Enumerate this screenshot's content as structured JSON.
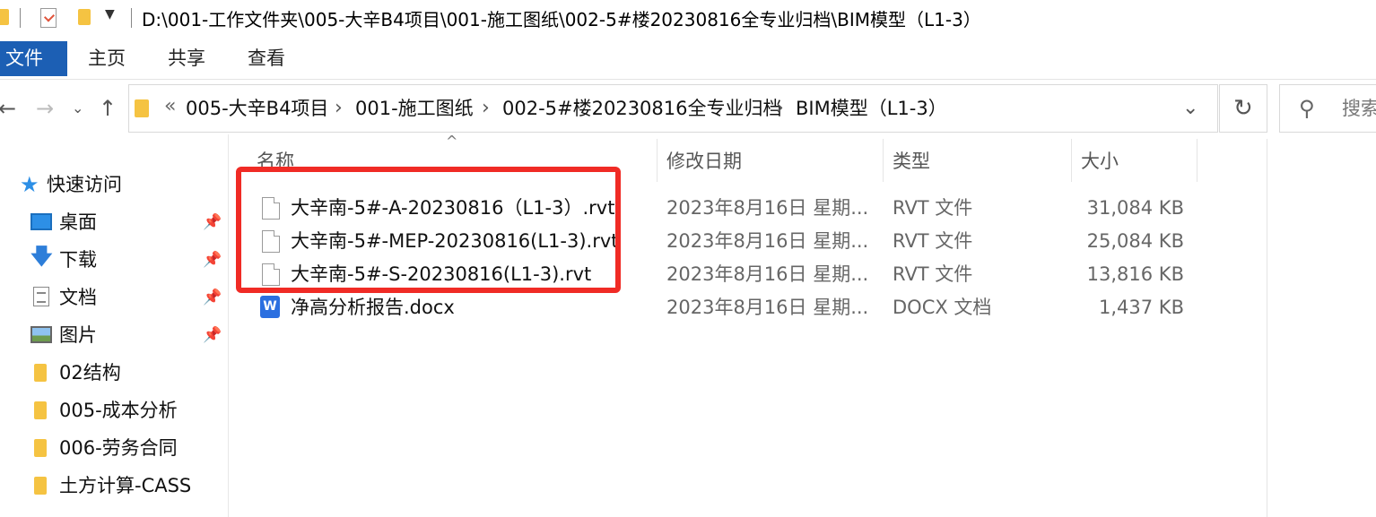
{
  "titlebar": {
    "path": "D:\\001-工作文件夹\\005-大辛B4项目\\001-施工图纸\\002-5#楼20230816全专业归档\\BIM模型（L1-3）"
  },
  "ribbon": {
    "tabs": [
      "文件",
      "主页",
      "共享",
      "查看"
    ]
  },
  "address": {
    "overflow": "«",
    "crumbs": [
      "005-大辛B4项目",
      "001-施工图纸",
      "002-5#楼20230816全专业归档",
      "BIM模型（L1-3）"
    ],
    "search_placeholder": "搜索"
  },
  "nav": {
    "quick_access": "快速访问",
    "items": [
      {
        "label": "桌面",
        "icon": "desktop-icon",
        "pinned": true
      },
      {
        "label": "下载",
        "icon": "download-icon",
        "pinned": true
      },
      {
        "label": "文档",
        "icon": "documents-icon",
        "pinned": true
      },
      {
        "label": "图片",
        "icon": "pictures-icon",
        "pinned": true
      },
      {
        "label": "02结构",
        "icon": "folder-icon",
        "pinned": false
      },
      {
        "label": "005-成本分析",
        "icon": "folder-icon",
        "pinned": false
      },
      {
        "label": "006-劳务合同",
        "icon": "folder-icon",
        "pinned": false
      },
      {
        "label": "土方计算-CASS",
        "icon": "folder-icon",
        "pinned": false
      }
    ]
  },
  "columns": [
    "名称",
    "修改日期",
    "类型",
    "大小"
  ],
  "files": [
    {
      "name": "大辛南-5#-A-20230816（L1-3）.rvt",
      "date": "2023年8月16日 星期...",
      "type": "RVT 文件",
      "size": "31,084 KB",
      "icon": "file-icon"
    },
    {
      "name": "大辛南-5#-MEP-20230816(L1-3).rvt",
      "date": "2023年8月16日 星期...",
      "type": "RVT 文件",
      "size": "25,084 KB",
      "icon": "file-icon"
    },
    {
      "name": "大辛南-5#-S-20230816(L1-3).rvt",
      "date": "2023年8月16日 星期...",
      "type": "RVT 文件",
      "size": "13,816 KB",
      "icon": "file-icon"
    },
    {
      "name": "净高分析报告.docx",
      "date": "2023年8月16日 星期...",
      "type": "DOCX 文档",
      "size": "1,437 KB",
      "icon": "wps-doc-icon"
    }
  ],
  "highlight_color": "#f02b25"
}
